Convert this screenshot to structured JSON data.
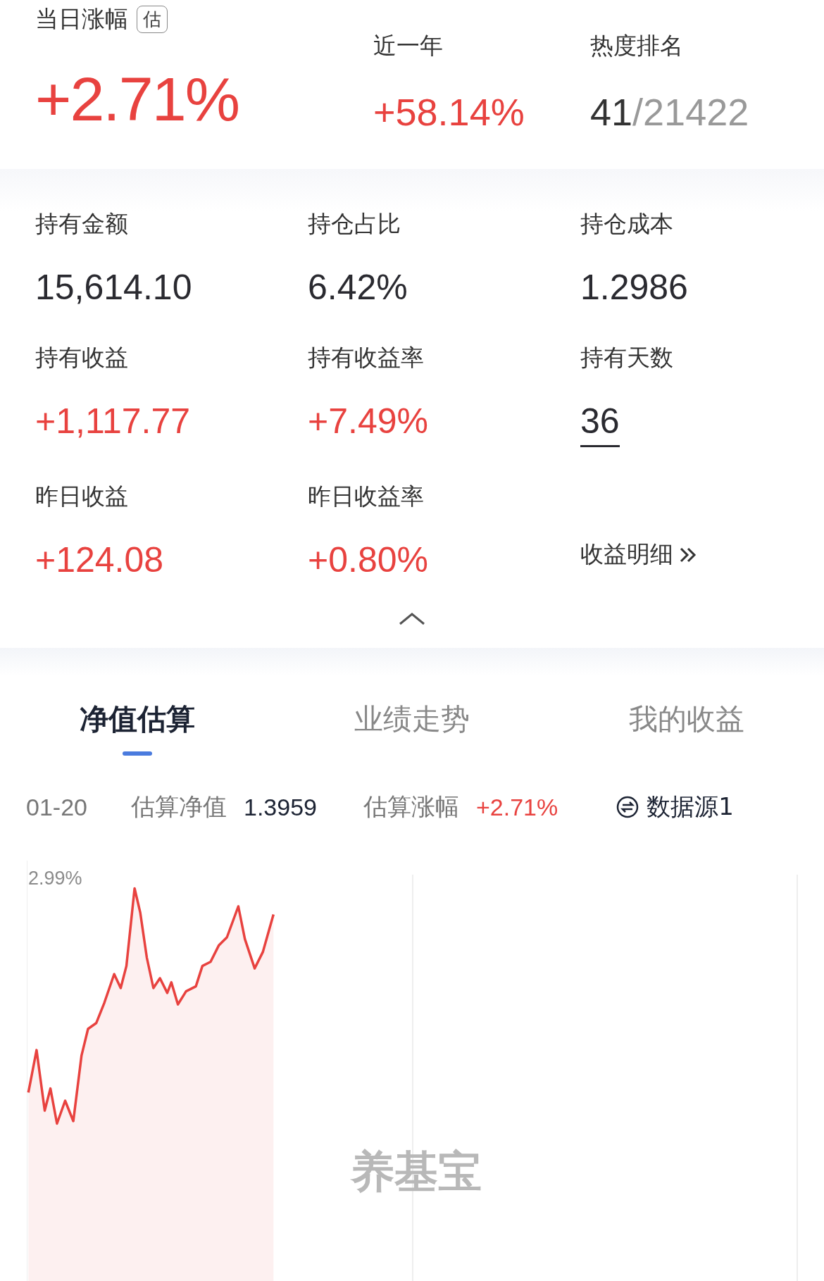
{
  "header": {
    "daily": {
      "label": "当日涨幅",
      "badge": "估",
      "value": "+2.71%"
    },
    "year": {
      "label": "近一年",
      "value": "+58.14%"
    },
    "rank": {
      "label": "热度排名",
      "rank": "41",
      "total": "/21422"
    }
  },
  "holdings": [
    {
      "kind": "plain",
      "label": "持有金额",
      "value": "15,614.10"
    },
    {
      "kind": "plain",
      "label": "持仓占比",
      "value": "6.42%"
    },
    {
      "kind": "plain",
      "label": "持仓成本",
      "value": "1.2986"
    },
    {
      "kind": "gain",
      "label": "持有收益",
      "value": "+1,117.77"
    },
    {
      "kind": "gain",
      "label": "持有收益率",
      "value": "+7.49%"
    },
    {
      "kind": "link",
      "label": "持有天数",
      "value": "36"
    },
    {
      "kind": "gain",
      "label": "昨日收益",
      "value": "+124.08"
    },
    {
      "kind": "gain",
      "label": "昨日收益率",
      "value": "+0.80%"
    },
    {
      "kind": "detail",
      "text": "收益明细"
    }
  ],
  "tabs": [
    {
      "label": "净值估算",
      "selected": true
    },
    {
      "label": "业绩走势",
      "selected": false
    },
    {
      "label": "我的收益",
      "selected": false
    }
  ],
  "estimate": {
    "date": "01-20",
    "nav_label": "估算净值",
    "nav": "1.3959",
    "change_label": "估算涨幅",
    "change": "+2.71%",
    "source": "数据源1"
  },
  "chart": {
    "top_label": "2.99%",
    "watermark": "养基宝"
  }
}
